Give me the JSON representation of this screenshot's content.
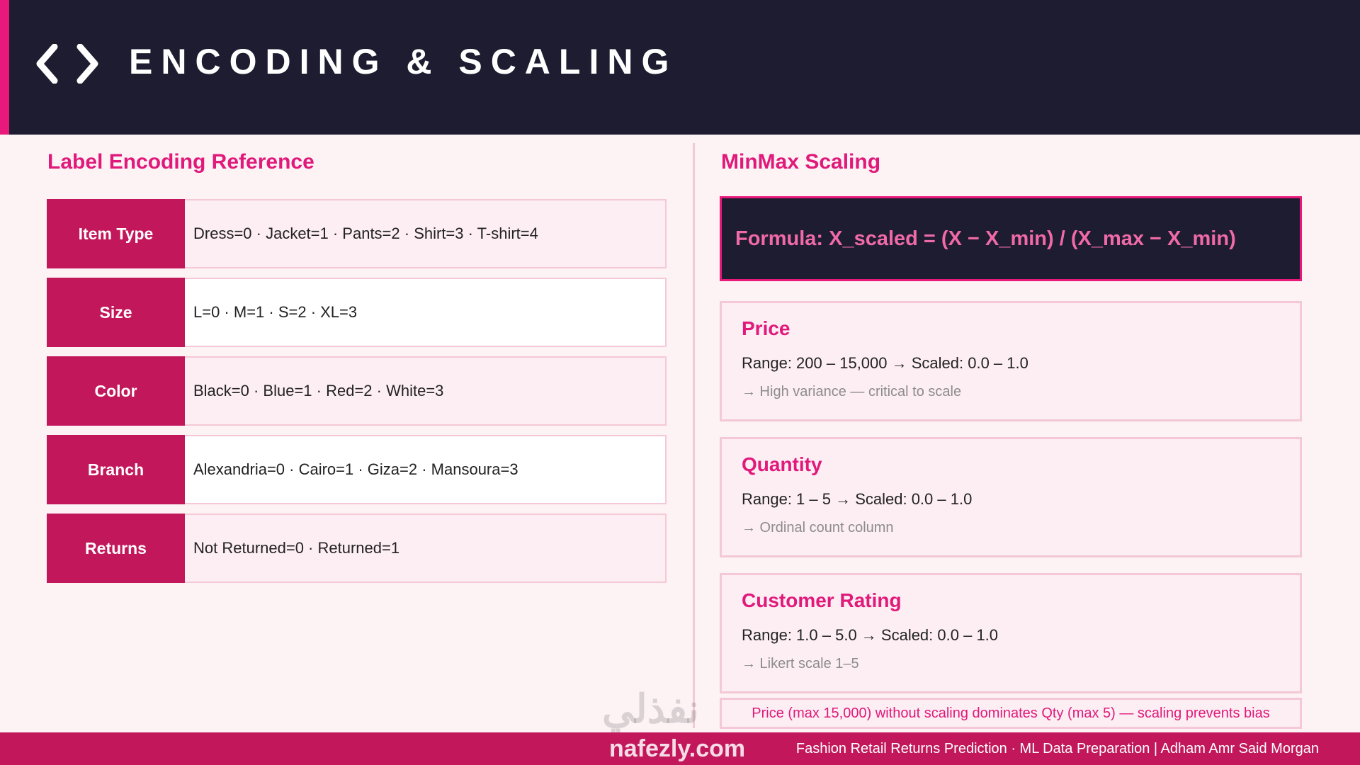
{
  "header": {
    "title": "ENCODING & SCALING",
    "icon": "code-brackets-icon",
    "accent_color": "#e8197a",
    "background_color": "#1e1c30"
  },
  "label_encoding": {
    "heading": "Label Encoding Reference",
    "rows": [
      {
        "label": "Item Type",
        "value": "Dress=0 · Jacket=1 · Pants=2 · Shirt=3 · T-shirt=4"
      },
      {
        "label": "Size",
        "value": "L=0 · M=1 · S=2 · XL=3"
      },
      {
        "label": "Color",
        "value": "Black=0 · Blue=1 · Red=2 · White=3"
      },
      {
        "label": "Branch",
        "value": "Alexandria=0 · Cairo=1 · Giza=2 · Mansoura=3"
      },
      {
        "label": "Returns",
        "value": "Not Returned=0 · Returned=1"
      }
    ]
  },
  "minmax": {
    "heading": "MinMax Scaling",
    "formula": "Formula:  X_scaled = (X − X_min) / (X_max − X_min)",
    "cards": [
      {
        "title": "Price",
        "range": "Range: 200 – 15,000  →  Scaled: 0.0 – 1.0",
        "note": "→ High variance — critical to scale"
      },
      {
        "title": "Quantity",
        "range": "Range: 1 – 5  →  Scaled: 0.0 – 1.0",
        "note": "→ Ordinal count column"
      },
      {
        "title": "Customer Rating",
        "range": "Range: 1.0 – 5.0  →  Scaled: 0.0 – 1.0",
        "note": "→ Likert scale 1–5"
      }
    ],
    "bias_note": "Price (max 15,000) without scaling dominates Qty (max 5) — scaling prevents bias"
  },
  "watermark": {
    "arabic": "نفذلي",
    "site": "nafezly.com"
  },
  "footer": {
    "text": "Fashion Retail Returns Prediction · ML Data Preparation  |  Adham Amr Said Morgan",
    "background_color": "#c2185b"
  }
}
